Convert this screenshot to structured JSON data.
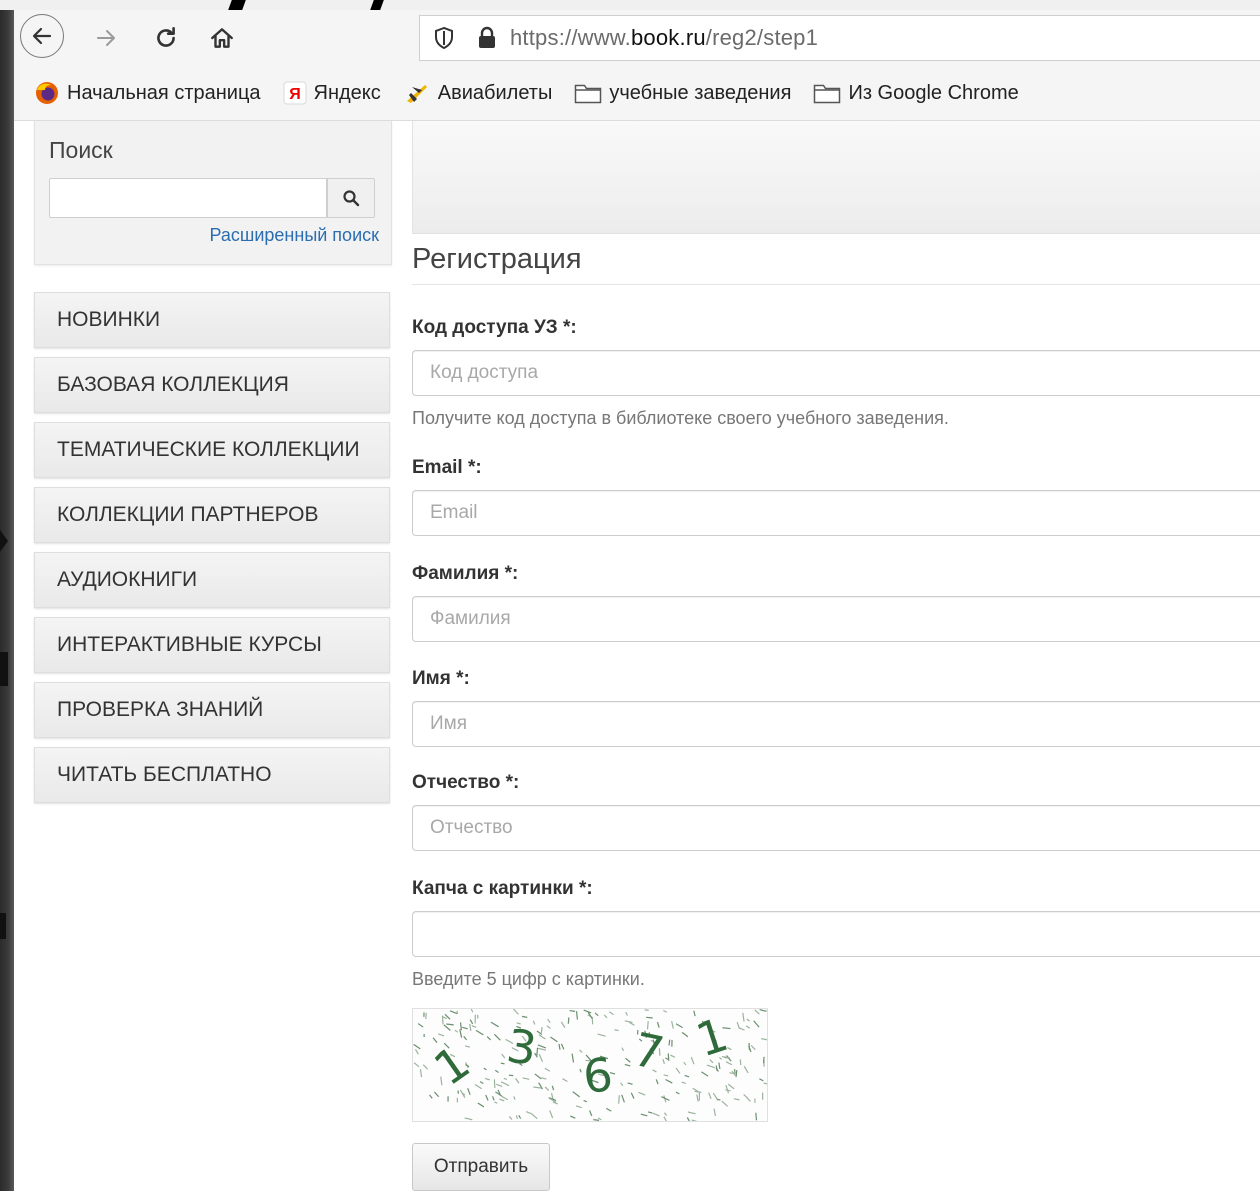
{
  "browser": {
    "url_prefix": "https://www.",
    "url_host": "book.ru",
    "url_path": "/reg2/step1"
  },
  "bookmarks": [
    {
      "label": "Начальная страница",
      "icon": "firefox-icon"
    },
    {
      "label": "Яндекс",
      "icon": "yandex-icon"
    },
    {
      "label": "Авиабилеты",
      "icon": "airplane-icon"
    },
    {
      "label": "учебные заведения",
      "icon": "folder-icon"
    },
    {
      "label": "Из Google Chrome",
      "icon": "folder-icon"
    }
  ],
  "sidebar": {
    "search_title": "Поиск",
    "advanced_search": "Расширенный поиск",
    "menu": [
      "НОВИНКИ",
      "БАЗОВАЯ КОЛЛЕКЦИЯ",
      "ТЕМАТИЧЕСКИЕ КОЛЛЕКЦИИ",
      "КОЛЛЕКЦИИ ПАРТНЕРОВ",
      "АУДИОКНИГИ",
      "ИНТЕРАКТИВНЫЕ КУРСЫ",
      "ПРОВЕРКА ЗНАНИЙ",
      "ЧИТАТЬ БЕСПЛАТНО"
    ]
  },
  "form": {
    "title": "Регистрация",
    "access_code": {
      "label": "Код доступа УЗ *:",
      "placeholder": "Код доступа",
      "help": "Получите код доступа в библиотеке своего учебного заведения."
    },
    "email": {
      "label": "Email *:",
      "placeholder": "Email"
    },
    "surname": {
      "label": "Фамилия *:",
      "placeholder": "Фамилия"
    },
    "name": {
      "label": "Имя *:",
      "placeholder": "Имя"
    },
    "patronymic": {
      "label": "Отчество *:",
      "placeholder": "Отчество"
    },
    "captcha": {
      "label": "Капча с картинки *:",
      "placeholder": "",
      "help": "Введите 5 цифр с картинки.",
      "digits": "13671"
    },
    "submit": "Отправить"
  },
  "colors": {
    "link": "#2a6db0",
    "captcha_digits": "#2f6b3a"
  }
}
